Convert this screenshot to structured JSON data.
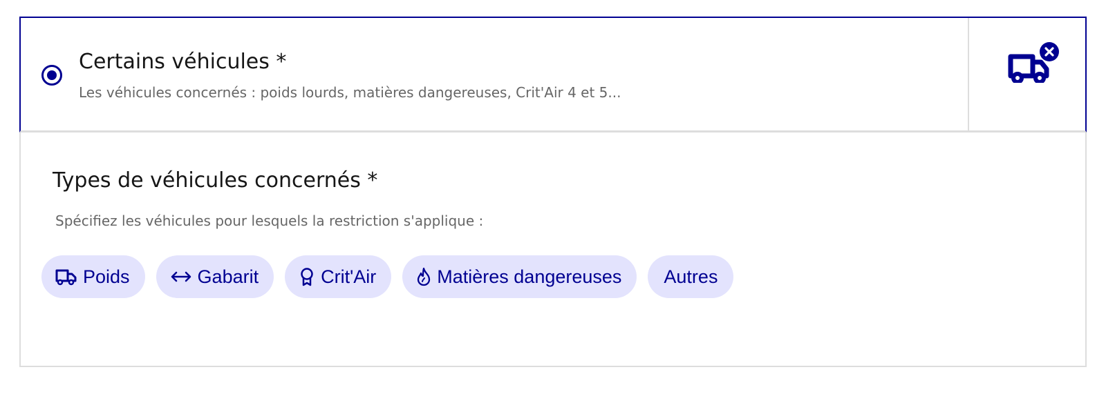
{
  "option": {
    "title": "Certains véhicules *",
    "description": "Les véhicules concernés : poids lourds, matières dangereuses, Crit'Air 4 et 5...",
    "selected": true,
    "icon": "truck-icon",
    "badge_icon": "close-icon"
  },
  "panel": {
    "title": "Types de véhicules concernés *",
    "hint": "Spécifiez les véhicules pour lesquels la restriction s'applique :"
  },
  "tags": [
    {
      "label": "Poids",
      "icon": "truck-icon"
    },
    {
      "label": "Gabarit",
      "icon": "arrows-horizontal-icon"
    },
    {
      "label": "Crit'Air",
      "icon": "award-icon"
    },
    {
      "label": "Matières dangereuses",
      "icon": "flame-icon"
    },
    {
      "label": "Autres",
      "icon": ""
    }
  ],
  "colors": {
    "accent": "#000091",
    "tag_background": "#e3e3fd",
    "border": "#dddddd",
    "muted_text": "#666666"
  }
}
